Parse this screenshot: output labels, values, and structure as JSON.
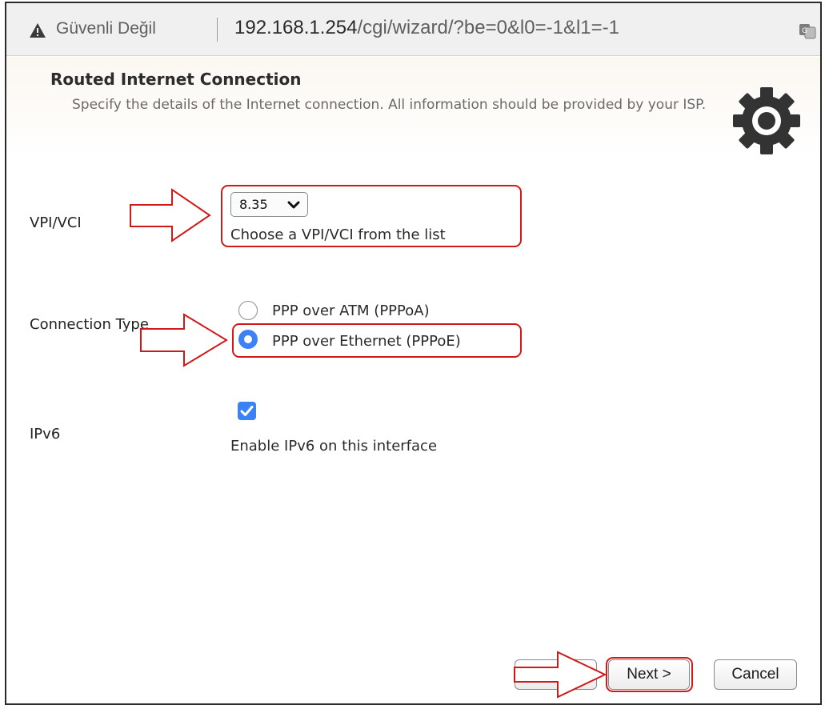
{
  "browser": {
    "security_label": "Güvenli Değil",
    "url_host": "192.168.1.254",
    "url_path": "/cgi/wizard/?be=0&l0=-1&l1=-1"
  },
  "header": {
    "title": "Routed Internet Connection",
    "description": "Specify the details of the Internet connection. All information should be provided by your ISP."
  },
  "form": {
    "vpi_vci": {
      "label": "VPI/VCI",
      "selected_value": "8.35",
      "help": "Choose a VPI/VCI from the list"
    },
    "connection_type": {
      "label": "Connection Type",
      "options": [
        {
          "label": "PPP over ATM (PPPoA)",
          "selected": false
        },
        {
          "label": "PPP over Ethernet (PPPoE)",
          "selected": true
        }
      ]
    },
    "ipv6": {
      "label": "IPv6",
      "checked": true,
      "help": "Enable IPv6 on this interface"
    }
  },
  "buttons": {
    "back": "< Back",
    "next": "Next >",
    "cancel": "Cancel"
  },
  "colors": {
    "annotation_red": "#d01919",
    "control_blue": "#3b82f6"
  },
  "icons": [
    "warning-icon",
    "translate-icon",
    "gear-icon",
    "chevron-down-icon",
    "checkmark-icon"
  ]
}
